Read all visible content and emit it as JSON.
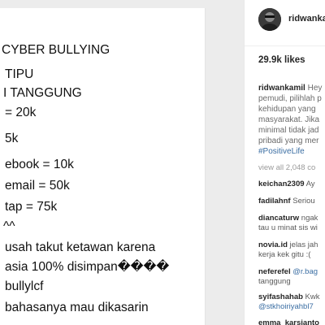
{
  "post_image": {
    "lines": [
      "CYBER BULLYING",
      "TIPU",
      "I TANGGUNG",
      "= 20k",
      "5k",
      "ebook = 10k",
      "email = 50k",
      "tap = 75k",
      "^^",
      "usah takut ketawan karena",
      "asia 100% disimpan����",
      "bullylcf",
      "bahasanya mau dikasarin"
    ]
  },
  "header": {
    "username": "ridwanka"
  },
  "likes": "29.9k likes",
  "caption": {
    "username": "ridwankamil",
    "line1": " Hey",
    "line2": "pemudi, pilihlah p",
    "line3": "kehidupan yang",
    "line4": "masyarakat. Jika",
    "line5": "minimal tidak jad",
    "line6": "pribadi yang mer",
    "hashtag": "#PositiveLife"
  },
  "view_all": "view all 2,048 co",
  "comments": [
    {
      "user": "keichan2309",
      "text": " Ay",
      "line2": ""
    },
    {
      "user": "fadilahnf",
      "text": " Seriou",
      "line2": ""
    },
    {
      "user": "diancaturw",
      "text": " ngak",
      "line2": "tau u minat sis wi"
    },
    {
      "user": "novia.id",
      "text": " jelas jah",
      "line2_mention": "",
      "line2": "kerja kek gitu :("
    },
    {
      "user": "neferefel",
      "mention": "@r.bag",
      "line2": "tanggung"
    },
    {
      "user": "syifashahab",
      "text": " Kwk",
      "line2_mention": "@stkhoiriyahbl7"
    },
    {
      "user": "emma_karsianto",
      "text": "",
      "line2": ""
    }
  ],
  "colors": {
    "link": "#3b6ea3",
    "text": "#262626",
    "muted": "#9a9a9a"
  }
}
